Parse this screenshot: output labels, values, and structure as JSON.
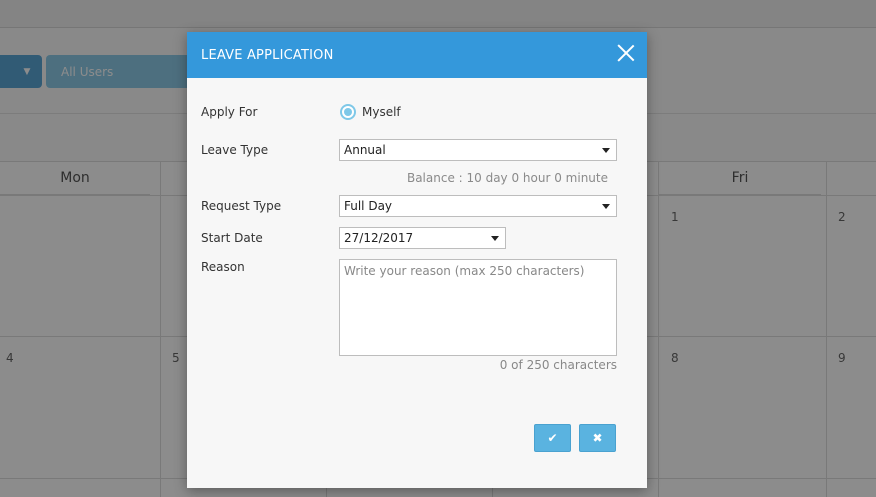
{
  "background": {
    "filter_button_icon": "caret-down-icon",
    "users_filter_label": "All Users",
    "day_headers": {
      "mon": "Mon",
      "fri": "Fri"
    },
    "row1_day_numbers": {
      "fri": "1",
      "sat": "2"
    },
    "row2_day_numbers": {
      "mon": "4",
      "tue": "5",
      "fri": "8",
      "sat": "9"
    }
  },
  "modal": {
    "title": "LEAVE APPLICATION",
    "close_icon": "close-icon",
    "fields": {
      "apply_for": {
        "label": "Apply For",
        "option_label": "Myself",
        "selected": true
      },
      "leave_type": {
        "label": "Leave Type",
        "value": "Annual"
      },
      "balance_text": "Balance : 10 day 0 hour 0 minute",
      "request_type": {
        "label": "Request Type",
        "value": "Full Day"
      },
      "start_date": {
        "label": "Start Date",
        "value": "27/12/2017"
      },
      "reason": {
        "label": "Reason",
        "placeholder": "Write your reason (max 250 characters)",
        "value": "",
        "counter_text": "0 of 250 characters"
      }
    },
    "actions": {
      "confirm_icon": "check-icon",
      "confirm_glyph": "✔",
      "cancel_icon": "cross-icon",
      "cancel_glyph": "✖"
    }
  },
  "colors": {
    "header": "#3498db",
    "button": "#5ab3e0",
    "radio": "#7ec8e8"
  }
}
